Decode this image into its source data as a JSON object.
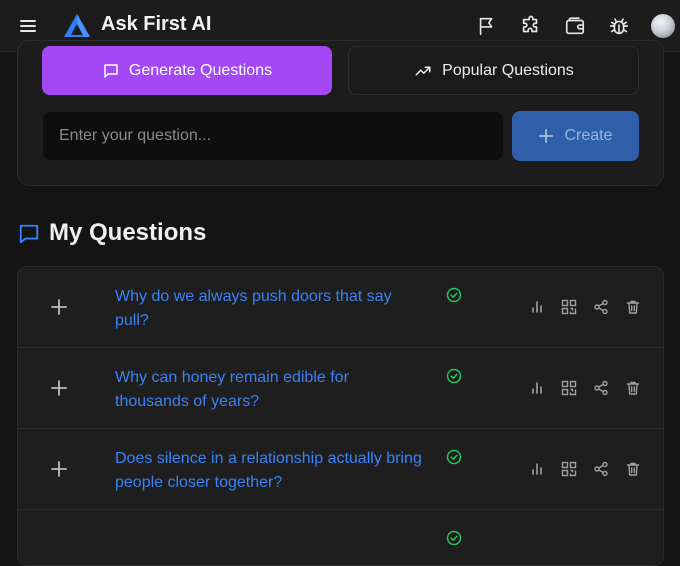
{
  "header": {
    "app_title": "Ask First AI",
    "icons": [
      "menu-icon",
      "logo-icon",
      "flag-icon",
      "puzzle-icon",
      "wallet-icon",
      "bug-icon",
      "avatar"
    ]
  },
  "actions": {
    "generate_label": "Generate Questions",
    "popular_label": "Popular Questions"
  },
  "input": {
    "placeholder": "Enter your question...",
    "value": ""
  },
  "create": {
    "label": "Create"
  },
  "section": {
    "title": "My Questions"
  },
  "questions": [
    {
      "text": "Why do we always push doors that say pull?",
      "status": "verified"
    },
    {
      "text": "Why can honey remain edible for thousands of years?",
      "status": "verified"
    },
    {
      "text": "Does silence in a relationship actually bring people closer together?",
      "status": "verified"
    },
    {
      "text": "",
      "status": "verified"
    }
  ],
  "colors": {
    "background": "#141414",
    "topbar": "#1c1c1c",
    "accent_purple": "#a448f5",
    "link_blue": "#3b82f6",
    "create_blue": "#2f5fa8",
    "check_green": "#22c55e"
  }
}
